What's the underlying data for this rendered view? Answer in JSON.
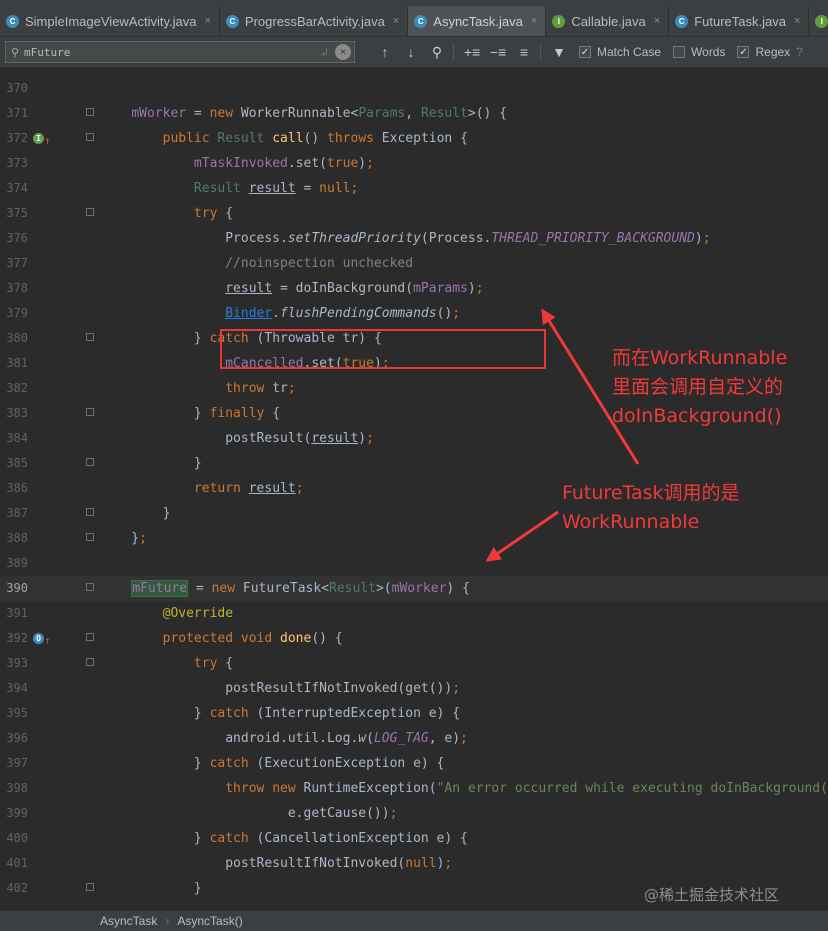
{
  "tabs": [
    {
      "label": "SimpleImageViewActivity.java",
      "icon": "class-icon",
      "active": false
    },
    {
      "label": "ProgressBarActivity.java",
      "icon": "class-icon",
      "active": false
    },
    {
      "label": "AsyncTask.java",
      "icon": "class-icon",
      "active": true
    },
    {
      "label": "Callable.java",
      "icon": "interface-icon",
      "active": false
    },
    {
      "label": "FutureTask.java",
      "icon": "class-icon",
      "active": false
    }
  ],
  "search": {
    "value": "mFuture",
    "match_case_label": "Match Case",
    "match_case_checked": true,
    "words_label": "Words",
    "words_checked": false,
    "regex_label": "Regex",
    "regex_checked": true,
    "help": "?"
  },
  "code_lines": [
    {
      "n": "370",
      "html": ""
    },
    {
      "n": "371",
      "html": "<span class=\"fld\">mWorker</span> = <span class=\"kw\">new</span> WorkerRunnable&lt;<span class=\"gen\">Params</span>, <span class=\"gen\">Result</span>&gt;() {"
    },
    {
      "n": "372",
      "html": "    <span class=\"kw\">public</span> <span class=\"gen\">Result</span> <span class=\"mth\">call</span>() <span class=\"kw\">throws</span> Exception {"
    },
    {
      "n": "373",
      "html": "        <span class=\"fld\">mTaskInvoked</span>.set(<span class=\"kw\">true</span>)<span class=\"kw\">;</span>"
    },
    {
      "n": "374",
      "html": "        <span class=\"gen\">Result</span> <span class=\"ul\">result</span> = <span class=\"kw\">null;</span>"
    },
    {
      "n": "375",
      "html": "        <span class=\"kw\">try</span> {"
    },
    {
      "n": "376",
      "html": "            Process.<span class=\"itf\">setThreadPriority</span>(Process.<span class=\"fld itf\">THREAD_PRIORITY_BACKGROUND</span>)<span class=\"kw\">;</span>"
    },
    {
      "n": "377",
      "html": "            <span class=\"cmt\">//noinspection unchecked</span>"
    },
    {
      "n": "378",
      "html": "            <span class=\"ul\">result</span> = doInBackground(<span class=\"fld\">mParams</span>)<span class=\"kw\">;</span>"
    },
    {
      "n": "379",
      "html": "            <span class=\"link\">Binder</span>.<span class=\"itf\">flushPendingCommands</span>()<span class=\"kw\">;</span>"
    },
    {
      "n": "380",
      "html": "        } <span class=\"kw\">catch</span> (Throwable tr) {"
    },
    {
      "n": "381",
      "html": "            <span class=\"fld\">mCancelled</span>.set(<span class=\"kw\">true</span>)<span class=\"kw\">;</span>"
    },
    {
      "n": "382",
      "html": "            <span class=\"kw\">throw</span> tr<span class=\"kw\">;</span>"
    },
    {
      "n": "383",
      "html": "        } <span class=\"kw\">finally</span> {"
    },
    {
      "n": "384",
      "html": "            postResult(<span class=\"ul\">result</span>)<span class=\"kw\">;</span>"
    },
    {
      "n": "385",
      "html": "        }"
    },
    {
      "n": "386",
      "html": "        <span class=\"kw\">return</span> <span class=\"ul\">result</span><span class=\"kw\">;</span>"
    },
    {
      "n": "387",
      "html": "    }"
    },
    {
      "n": "388",
      "html": "}<span class=\"kw\">;</span>"
    },
    {
      "n": "389",
      "html": ""
    },
    {
      "n": "390",
      "html": "<span class=\"fld mk\">mFuture</span> = <span class=\"kw\">new</span> FutureTask&lt;<span class=\"gen\">Result</span>&gt;(<span class=\"fld\">mWorker</span>) {"
    },
    {
      "n": "391",
      "html": "    <span class=\"ann\">@Override</span>"
    },
    {
      "n": "392",
      "html": "    <span class=\"kw\">protected void</span> <span class=\"mth\">done</span>() {"
    },
    {
      "n": "393",
      "html": "        <span class=\"kw\">try</span> {"
    },
    {
      "n": "394",
      "html": "            postResultIfNotInvoked(get())<span class=\"kw\">;</span>"
    },
    {
      "n": "395",
      "html": "        } <span class=\"kw\">catch</span> (InterruptedException e) {"
    },
    {
      "n": "396",
      "html": "            android.util.Log.<span class=\"itf\">w</span>(<span class=\"fld itf\">LOG_TAG</span>, e)<span class=\"kw\">;</span>"
    },
    {
      "n": "397",
      "html": "        } <span class=\"kw\">catch</span> (ExecutionException e) {"
    },
    {
      "n": "398",
      "html": "            <span class=\"kw\">throw new</span> RuntimeException(<span class=\"str\">\"An error occurred while executing doInBackground()\"</span>,"
    },
    {
      "n": "399",
      "html": "                    e.getCause())<span class=\"kw\">;</span>"
    },
    {
      "n": "400",
      "html": "        } <span class=\"kw\">catch</span> (CancellationException e) {"
    },
    {
      "n": "401",
      "html": "            postResultIfNotInvoked(<span class=\"kw\">null</span>)<span class=\"kw\">;</span>"
    },
    {
      "n": "402",
      "html": "        }"
    }
  ],
  "annotations": {
    "note1": "而在WorkRunnable\n里面会调用自定义的\ndoInBackground()",
    "note2": "FutureTask调用的是\nWorkRunnable",
    "color": "#f03a3a"
  },
  "statusbar": {
    "crumb1": "AsyncTask",
    "crumb2": "AsyncTask()"
  },
  "watermark": "@稀土掘金技术社区"
}
